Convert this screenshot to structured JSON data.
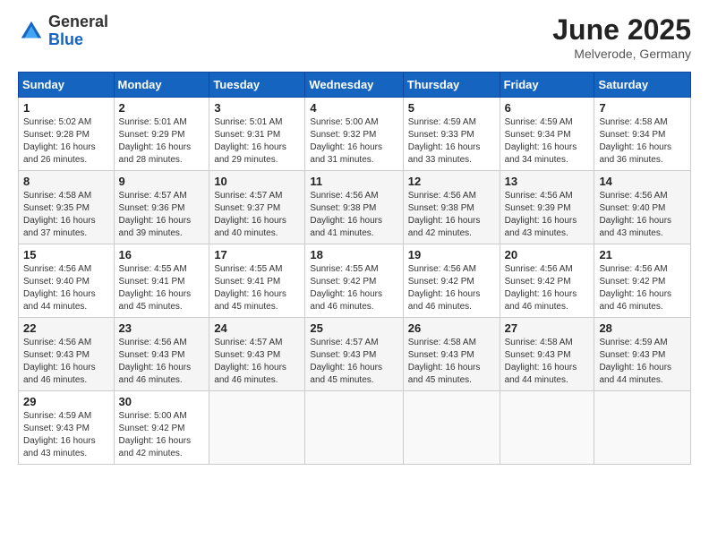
{
  "logo": {
    "general": "General",
    "blue": "Blue"
  },
  "title": "June 2025",
  "location": "Melverode, Germany",
  "days_header": [
    "Sunday",
    "Monday",
    "Tuesday",
    "Wednesday",
    "Thursday",
    "Friday",
    "Saturday"
  ],
  "weeks": [
    [
      {
        "day": "1",
        "sunrise": "Sunrise: 5:02 AM",
        "sunset": "Sunset: 9:28 PM",
        "daylight": "Daylight: 16 hours and 26 minutes."
      },
      {
        "day": "2",
        "sunrise": "Sunrise: 5:01 AM",
        "sunset": "Sunset: 9:29 PM",
        "daylight": "Daylight: 16 hours and 28 minutes."
      },
      {
        "day": "3",
        "sunrise": "Sunrise: 5:01 AM",
        "sunset": "Sunset: 9:31 PM",
        "daylight": "Daylight: 16 hours and 29 minutes."
      },
      {
        "day": "4",
        "sunrise": "Sunrise: 5:00 AM",
        "sunset": "Sunset: 9:32 PM",
        "daylight": "Daylight: 16 hours and 31 minutes."
      },
      {
        "day": "5",
        "sunrise": "Sunrise: 4:59 AM",
        "sunset": "Sunset: 9:33 PM",
        "daylight": "Daylight: 16 hours and 33 minutes."
      },
      {
        "day": "6",
        "sunrise": "Sunrise: 4:59 AM",
        "sunset": "Sunset: 9:34 PM",
        "daylight": "Daylight: 16 hours and 34 minutes."
      },
      {
        "day": "7",
        "sunrise": "Sunrise: 4:58 AM",
        "sunset": "Sunset: 9:34 PM",
        "daylight": "Daylight: 16 hours and 36 minutes."
      }
    ],
    [
      {
        "day": "8",
        "sunrise": "Sunrise: 4:58 AM",
        "sunset": "Sunset: 9:35 PM",
        "daylight": "Daylight: 16 hours and 37 minutes."
      },
      {
        "day": "9",
        "sunrise": "Sunrise: 4:57 AM",
        "sunset": "Sunset: 9:36 PM",
        "daylight": "Daylight: 16 hours and 39 minutes."
      },
      {
        "day": "10",
        "sunrise": "Sunrise: 4:57 AM",
        "sunset": "Sunset: 9:37 PM",
        "daylight": "Daylight: 16 hours and 40 minutes."
      },
      {
        "day": "11",
        "sunrise": "Sunrise: 4:56 AM",
        "sunset": "Sunset: 9:38 PM",
        "daylight": "Daylight: 16 hours and 41 minutes."
      },
      {
        "day": "12",
        "sunrise": "Sunrise: 4:56 AM",
        "sunset": "Sunset: 9:38 PM",
        "daylight": "Daylight: 16 hours and 42 minutes."
      },
      {
        "day": "13",
        "sunrise": "Sunrise: 4:56 AM",
        "sunset": "Sunset: 9:39 PM",
        "daylight": "Daylight: 16 hours and 43 minutes."
      },
      {
        "day": "14",
        "sunrise": "Sunrise: 4:56 AM",
        "sunset": "Sunset: 9:40 PM",
        "daylight": "Daylight: 16 hours and 43 minutes."
      }
    ],
    [
      {
        "day": "15",
        "sunrise": "Sunrise: 4:56 AM",
        "sunset": "Sunset: 9:40 PM",
        "daylight": "Daylight: 16 hours and 44 minutes."
      },
      {
        "day": "16",
        "sunrise": "Sunrise: 4:55 AM",
        "sunset": "Sunset: 9:41 PM",
        "daylight": "Daylight: 16 hours and 45 minutes."
      },
      {
        "day": "17",
        "sunrise": "Sunrise: 4:55 AM",
        "sunset": "Sunset: 9:41 PM",
        "daylight": "Daylight: 16 hours and 45 minutes."
      },
      {
        "day": "18",
        "sunrise": "Sunrise: 4:55 AM",
        "sunset": "Sunset: 9:42 PM",
        "daylight": "Daylight: 16 hours and 46 minutes."
      },
      {
        "day": "19",
        "sunrise": "Sunrise: 4:56 AM",
        "sunset": "Sunset: 9:42 PM",
        "daylight": "Daylight: 16 hours and 46 minutes."
      },
      {
        "day": "20",
        "sunrise": "Sunrise: 4:56 AM",
        "sunset": "Sunset: 9:42 PM",
        "daylight": "Daylight: 16 hours and 46 minutes."
      },
      {
        "day": "21",
        "sunrise": "Sunrise: 4:56 AM",
        "sunset": "Sunset: 9:42 PM",
        "daylight": "Daylight: 16 hours and 46 minutes."
      }
    ],
    [
      {
        "day": "22",
        "sunrise": "Sunrise: 4:56 AM",
        "sunset": "Sunset: 9:43 PM",
        "daylight": "Daylight: 16 hours and 46 minutes."
      },
      {
        "day": "23",
        "sunrise": "Sunrise: 4:56 AM",
        "sunset": "Sunset: 9:43 PM",
        "daylight": "Daylight: 16 hours and 46 minutes."
      },
      {
        "day": "24",
        "sunrise": "Sunrise: 4:57 AM",
        "sunset": "Sunset: 9:43 PM",
        "daylight": "Daylight: 16 hours and 46 minutes."
      },
      {
        "day": "25",
        "sunrise": "Sunrise: 4:57 AM",
        "sunset": "Sunset: 9:43 PM",
        "daylight": "Daylight: 16 hours and 45 minutes."
      },
      {
        "day": "26",
        "sunrise": "Sunrise: 4:58 AM",
        "sunset": "Sunset: 9:43 PM",
        "daylight": "Daylight: 16 hours and 45 minutes."
      },
      {
        "day": "27",
        "sunrise": "Sunrise: 4:58 AM",
        "sunset": "Sunset: 9:43 PM",
        "daylight": "Daylight: 16 hours and 44 minutes."
      },
      {
        "day": "28",
        "sunrise": "Sunrise: 4:59 AM",
        "sunset": "Sunset: 9:43 PM",
        "daylight": "Daylight: 16 hours and 44 minutes."
      }
    ],
    [
      {
        "day": "29",
        "sunrise": "Sunrise: 4:59 AM",
        "sunset": "Sunset: 9:43 PM",
        "daylight": "Daylight: 16 hours and 43 minutes."
      },
      {
        "day": "30",
        "sunrise": "Sunrise: 5:00 AM",
        "sunset": "Sunset: 9:42 PM",
        "daylight": "Daylight: 16 hours and 42 minutes."
      },
      null,
      null,
      null,
      null,
      null
    ]
  ]
}
